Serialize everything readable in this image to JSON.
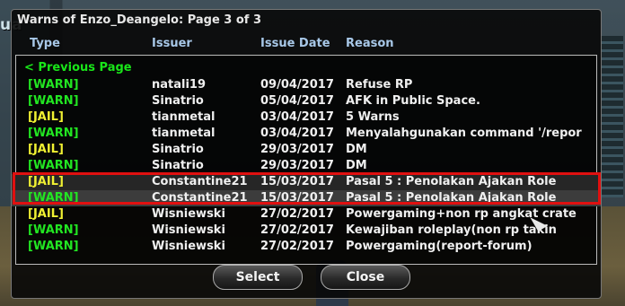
{
  "background": {
    "sign_text": "ua"
  },
  "dialog": {
    "title": "Warns of Enzo_Deangelo: Page 3 of 3",
    "columns": {
      "type": "Type",
      "issuer": "Issuer",
      "date": "Issue Date",
      "reason": "Reason"
    },
    "previous_page": "< Previous Page",
    "rows": [
      {
        "type": "[WARN]",
        "issuer": "natali19",
        "date": "09/04/2017",
        "reason": "Refuse RP"
      },
      {
        "type": "[WARN]",
        "issuer": "Sinatrio",
        "date": "05/04/2017",
        "reason": "AFK in Public Space."
      },
      {
        "type": "[JAIL]",
        "issuer": "tianmetal",
        "date": "03/04/2017",
        "reason": "5 Warns"
      },
      {
        "type": "[WARN]",
        "issuer": "tianmetal",
        "date": "03/04/2017",
        "reason": "Menyalahgunakan command '/repor"
      },
      {
        "type": "[JAIL]",
        "issuer": "Sinatrio",
        "date": "29/03/2017",
        "reason": "DM"
      },
      {
        "type": "[WARN]",
        "issuer": "Sinatrio",
        "date": "29/03/2017",
        "reason": "DM"
      },
      {
        "type": "[JAIL]",
        "issuer": "Constantine21",
        "date": "15/03/2017",
        "reason": "Pasal 5 : Penolakan Ajakan Role"
      },
      {
        "type": "[WARN]",
        "issuer": "Constantine21",
        "date": "15/03/2017",
        "reason": "Pasal 5 : Penolakan Ajakan Role"
      },
      {
        "type": "[JAIL]",
        "issuer": "Wisniewski",
        "date": "27/02/2017",
        "reason": "Powergaming+non rp angkat crate"
      },
      {
        "type": "[WARN]",
        "issuer": "Wisniewski",
        "date": "27/02/2017",
        "reason": "Kewajiban roleplay(non rp takin"
      },
      {
        "type": "[WARN]",
        "issuer": "Wisniewski",
        "date": "27/02/2017",
        "reason": "Powergaming(report-forum)"
      }
    ],
    "buttons": {
      "select": "Select",
      "close": "Close"
    }
  },
  "colors": {
    "warn": "#22e622",
    "jail": "#f0f032",
    "highlight": "#e01010",
    "header": "#a8c8e8"
  }
}
